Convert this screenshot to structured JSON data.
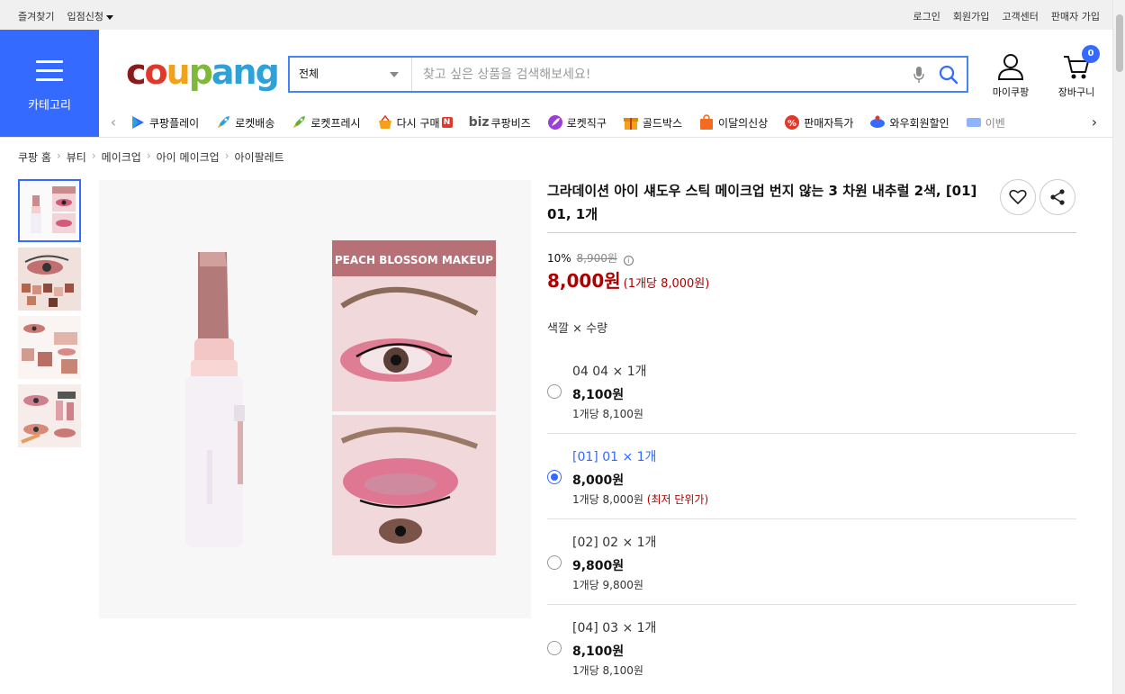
{
  "topbar": {
    "left": [
      "즐겨찾기",
      "입점신청"
    ],
    "right": [
      "로그인",
      "회원가입",
      "고객센터",
      "판매자 가입"
    ]
  },
  "category": {
    "label": "카테고리"
  },
  "logo": {
    "parts": [
      "c",
      "o",
      "u",
      "p",
      "ang"
    ]
  },
  "search": {
    "category_value": "전체",
    "placeholder": "찾고 싶은 상품을 검색해보세요!"
  },
  "header": {
    "mypage": "마이쿠팡",
    "cart": "장바구니",
    "cart_count": "0"
  },
  "shortcuts": [
    "쿠팡플레이",
    "로켓배송",
    "로켓프레시",
    "다시 구매",
    "쿠팡비즈",
    "로켓직구",
    "골드박스",
    "이달의신상",
    "판매자특가",
    "와우회원할인",
    "이벤"
  ],
  "shortcut_extras": {
    "rebuy_badge": "N",
    "biz_prefix": "biz"
  },
  "breadcrumb": [
    "쿠팡 홈",
    "뷰티",
    "메이크업",
    "아이 메이크업",
    "아이팔레트"
  ],
  "product": {
    "title": "그라데이션 아이 섀도우 스틱 메이크업 번지 않는 3 차원 내추럴 2색, [01] 01, 1개",
    "discount_rate": "10%",
    "original_price": "8,900원",
    "price": "8,000원",
    "unit_price": "(1개당 8,000원)",
    "option_label": "색깔 × 수량",
    "image_text": "PEACH BLOSSOM MAKEUP"
  },
  "options": [
    {
      "name": "04 04 × 1개",
      "price": "8,100원",
      "per": "1개당 8,100원",
      "lowest": "",
      "selected": false
    },
    {
      "name": "[01] 01 × 1개",
      "price": "8,000원",
      "per": "1개당 8,000원",
      "lowest": "(최저 단위가)",
      "selected": true
    },
    {
      "name": "[02] 02 × 1개",
      "price": "9,800원",
      "per": "1개당 9,800원",
      "lowest": "",
      "selected": false
    },
    {
      "name": "[04] 03 × 1개",
      "price": "8,100원",
      "per": "1개당 8,100원",
      "lowest": "",
      "selected": false
    }
  ],
  "colors": {
    "accent": "#346aff",
    "price": "#ae0000"
  }
}
